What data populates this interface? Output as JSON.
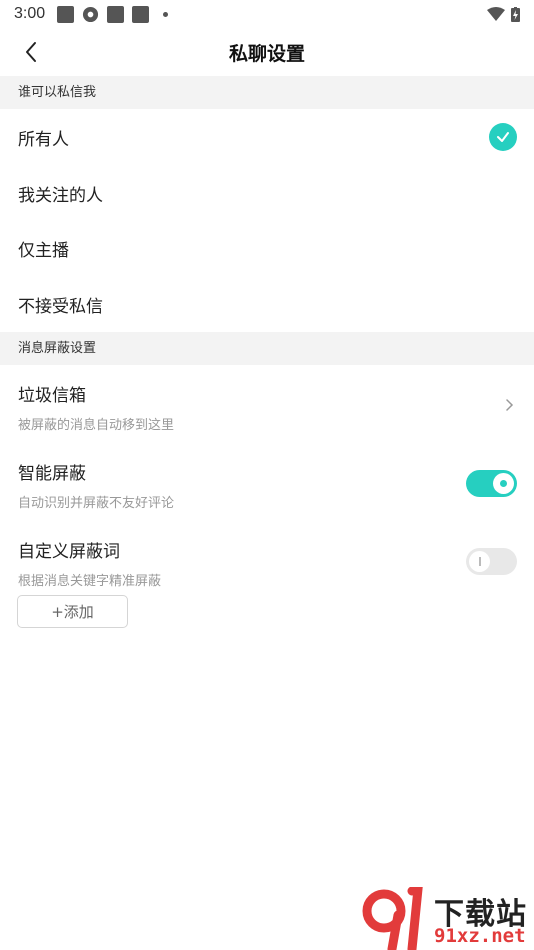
{
  "statusbar": {
    "time": "3:00"
  },
  "header": {
    "title": "私聊设置"
  },
  "section_who": {
    "title": "谁可以私信我",
    "options": [
      {
        "label": "所有人",
        "selected": true
      },
      {
        "label": "我关注的人",
        "selected": false
      },
      {
        "label": "仅主播",
        "selected": false
      },
      {
        "label": "不接受私信",
        "selected": false
      }
    ]
  },
  "section_block": {
    "title": "消息屏蔽设置",
    "spam": {
      "title": "垃圾信箱",
      "sub": "被屏蔽的消息自动移到这里"
    },
    "smart": {
      "title": "智能屏蔽",
      "sub": "自动识别并屏蔽不友好评论",
      "enabled": true
    },
    "custom": {
      "title": "自定义屏蔽词",
      "sub": "根据消息关键字精准屏蔽",
      "enabled": false
    },
    "add_label": "+添加"
  },
  "watermark": {
    "text": "下载站",
    "url": "91xz.net"
  },
  "colors": {
    "accent": "#26cfc0",
    "section_bg": "#f3f3f3"
  }
}
